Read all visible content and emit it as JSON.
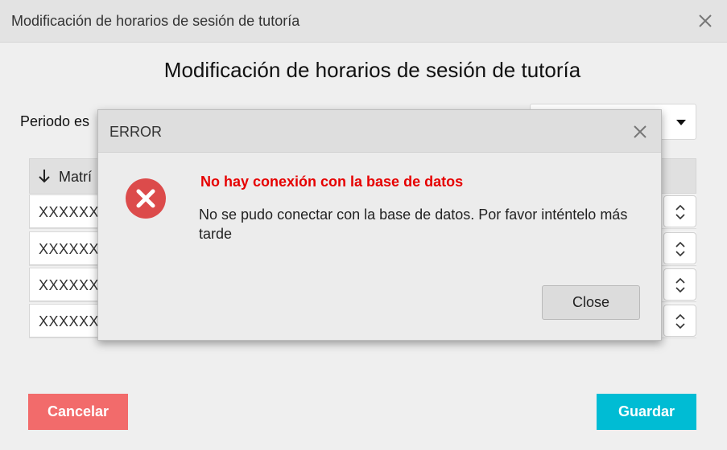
{
  "window": {
    "title": "Modificación de horarios de sesión de tutoría"
  },
  "page": {
    "heading": "Modificación de horarios de sesión de tutoría",
    "period_label": "Periodo es",
    "period_value": ""
  },
  "table": {
    "header": "Matrí",
    "rows": [
      {
        "code": "XXXXXX"
      },
      {
        "code": "XXXXXX"
      },
      {
        "code": "XXXXXX"
      },
      {
        "code": "XXXXXX"
      }
    ]
  },
  "footer": {
    "cancel_label": "Cancelar",
    "save_label": "Guardar",
    "cancel_color": "#f26b6b",
    "save_color": "#00bcd4"
  },
  "dialog": {
    "title": "ERROR",
    "error_title": "No hay conexión con la base de datos",
    "message": "No se pudo conectar con la base de datos. Por favor inténtelo más tarde",
    "close_label": "Close",
    "error_color": "#e60000",
    "icon": "error-circle-icon"
  }
}
